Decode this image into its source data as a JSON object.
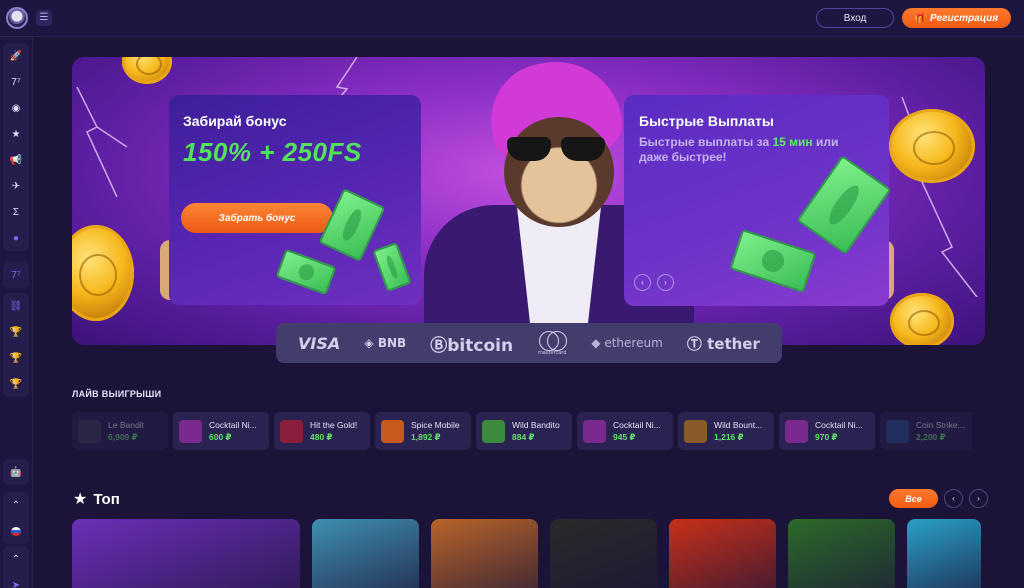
{
  "header": {
    "login_label": "Вход",
    "register_label": "Регистрация"
  },
  "sidebar": {
    "items": [
      {
        "icon": "rocket-icon"
      },
      {
        "icon": "777-icon"
      },
      {
        "icon": "target-icon"
      },
      {
        "icon": "star-icon"
      },
      {
        "icon": "megaphone-icon"
      },
      {
        "icon": "plane-icon"
      },
      {
        "icon": "sigma-icon"
      },
      {
        "icon": "planet-icon"
      },
      {
        "icon": "777-icon"
      },
      {
        "icon": "link-icon"
      },
      {
        "icon": "trophy-icon"
      },
      {
        "icon": "trophy-icon"
      },
      {
        "icon": "trophy-icon"
      },
      {
        "icon": "android-icon"
      },
      {
        "icon": "chevron-up-icon"
      },
      {
        "icon": "russia-flag-icon"
      },
      {
        "icon": "chevron-up-icon"
      },
      {
        "icon": "telegram-icon"
      }
    ]
  },
  "banner": {
    "left_card": {
      "title": "Забирай бонус",
      "bonus": "150% + 250FS",
      "cta": "Забрать бонус"
    },
    "right_card": {
      "title": "Быстрые Выплаты",
      "sub_before": "Быстрые выплаты за ",
      "sub_highlight": "15 мин",
      "sub_after": " или даже быстрее!"
    },
    "arrow_prev": "‹",
    "arrow_next": "›"
  },
  "payments": {
    "visa": "VISA",
    "bnb": "◈ BNB",
    "bitcoin": "Ⓑbitcoin",
    "mastercard": "mastercard",
    "ethereum": "◆ ethereum",
    "tether": "Ⓣ tether"
  },
  "live_wins": {
    "title": "ЛАЙВ ВЫИГРЫШИ",
    "items": [
      {
        "game": "Le Bandit",
        "amount": "6,909 ₽",
        "color": "#3a3f55"
      },
      {
        "game": "Cocktail Ni...",
        "amount": "600 ₽",
        "color": "#7a2a8e"
      },
      {
        "game": "Hit the Gold!",
        "amount": "480 ₽",
        "color": "#8b1f3a"
      },
      {
        "game": "Spice Mobile",
        "amount": "1,892 ₽",
        "color": "#c95a1d"
      },
      {
        "game": "Wild Bandito",
        "amount": "884 ₽",
        "color": "#3c8a3e"
      },
      {
        "game": "Cocktail Ni...",
        "amount": "945 ₽",
        "color": "#7a2a8e"
      },
      {
        "game": "Wild Bount...",
        "amount": "1,216 ₽",
        "color": "#8a5a2a"
      },
      {
        "game": "Cocktail Ni...",
        "amount": "970 ₽",
        "color": "#7a2a8e"
      },
      {
        "game": "Coin Strike...",
        "amount": "2,200 ₽",
        "color": "#2a4f8e"
      }
    ]
  },
  "top": {
    "title": "Топ",
    "all_label": "Все",
    "prev": "‹",
    "next": "›",
    "games": [
      {
        "color": "#6b2fb8"
      },
      {
        "color": "#3f8fb0"
      },
      {
        "color": "#b8642a"
      },
      {
        "color": "#2a2a2a"
      },
      {
        "color": "#c8301a"
      },
      {
        "color": "#2c6a2a"
      },
      {
        "color": "#2aa0c8"
      }
    ]
  }
}
